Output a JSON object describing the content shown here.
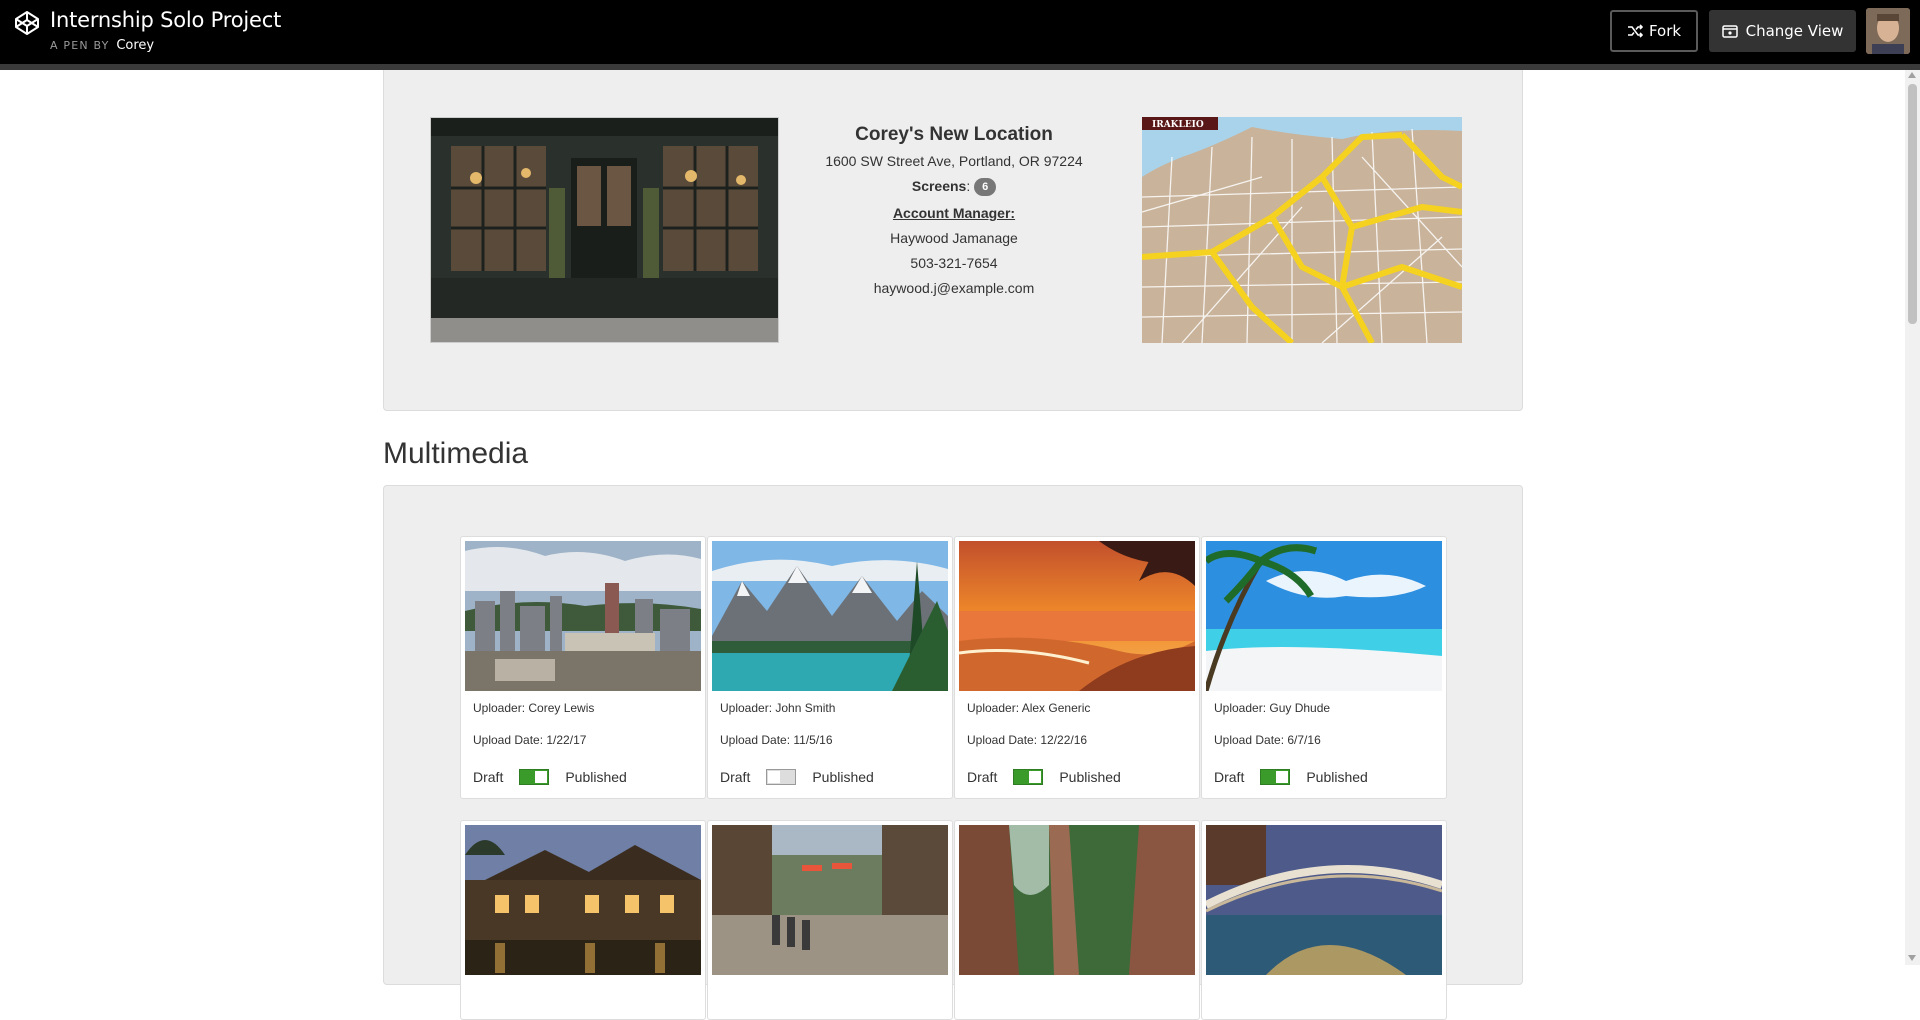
{
  "header": {
    "pen_title": "Internship Solo Project",
    "by_label": "A PEN BY",
    "author": "Corey",
    "fork_label": "Fork",
    "change_view_label": "Change View"
  },
  "location": {
    "name": "Corey's New Location",
    "address": "1600 SW Street Ave, Portland, OR 97224",
    "screens_label": "Screens",
    "screens_count": "6",
    "account_manager_label": "Account Manager:",
    "manager_name": "Haywood Jamanage",
    "manager_phone": "503-321-7654",
    "manager_email": "haywood.j@example.com",
    "map_label": "IRAKLEIO"
  },
  "multimedia": {
    "title": "Multimedia",
    "draft_label": "Draft",
    "published_label": "Published",
    "items": [
      {
        "uploader": "Uploader: Corey Lewis",
        "date": "Upload Date: 1/22/17",
        "published": true,
        "thumb": "city-skyline"
      },
      {
        "uploader": "Uploader: John Smith",
        "date": "Upload Date: 11/5/16",
        "published": false,
        "thumb": "mountain-lake"
      },
      {
        "uploader": "Uploader: Alex Generic",
        "date": "Upload Date: 12/22/16",
        "published": true,
        "thumb": "sunset-beach"
      },
      {
        "uploader": "Uploader: Guy Dhude",
        "date": "Upload Date: 6/7/16",
        "published": true,
        "thumb": "tropical-beach"
      }
    ],
    "row2_thumbs": [
      "lodge-night",
      "plaza-crowd",
      "canyon-cliffs",
      "bridge-night"
    ]
  },
  "colors": {
    "toggle_on": "#3a9a2a",
    "panel_bg": "#eeeeee",
    "topbar_bg": "#000000"
  }
}
